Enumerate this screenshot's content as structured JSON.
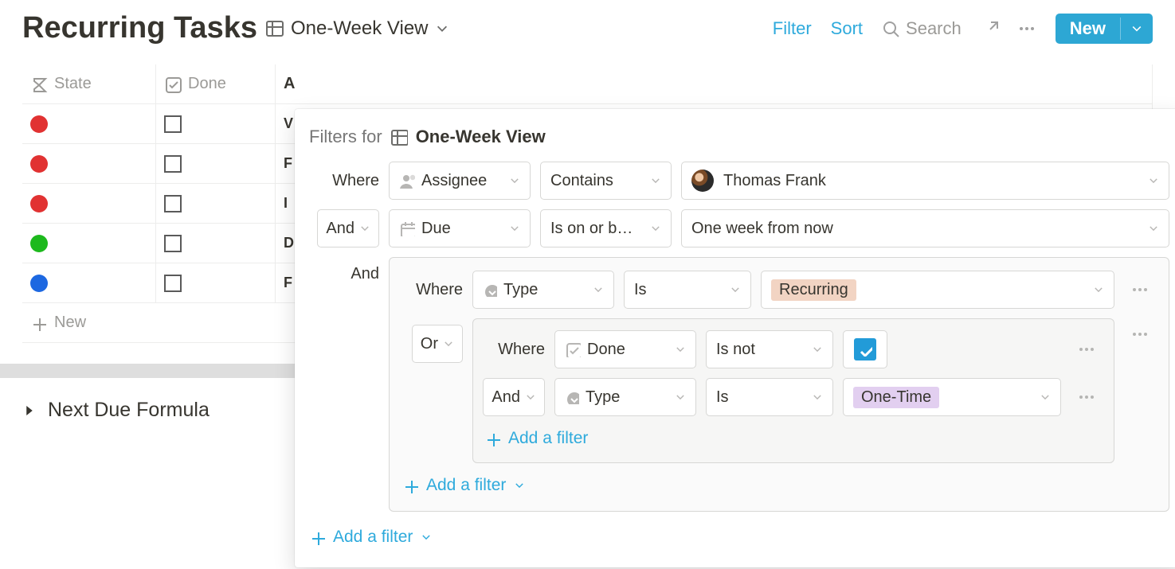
{
  "header": {
    "title": "Recurring Tasks",
    "view_name": "One-Week View",
    "filter": "Filter",
    "sort": "Sort",
    "search": "Search",
    "new": "New"
  },
  "columns": {
    "state": "State",
    "done": "Done"
  },
  "rows": [
    {
      "state_color": "red",
      "done": false,
      "name_initial": "V"
    },
    {
      "state_color": "red",
      "done": false,
      "name_initial": "F"
    },
    {
      "state_color": "red",
      "done": false,
      "name_initial": "I"
    },
    {
      "state_color": "green",
      "done": false,
      "name_initial": "D"
    },
    {
      "state_color": "blue",
      "done": false,
      "name_initial": "F"
    }
  ],
  "new_row": "New",
  "toggle": {
    "label": "Next Due Formula"
  },
  "filters": {
    "title_prefix": "Filters for",
    "view_name": "One-Week View",
    "rule1": {
      "conj": "Where",
      "property": "Assignee",
      "op": "Contains",
      "value": "Thomas Frank"
    },
    "rule2": {
      "conj": "And",
      "property": "Due",
      "op": "Is on or b…",
      "value": "One week from now"
    },
    "group": {
      "conj": "And",
      "rule_a": {
        "conj": "Where",
        "property": "Type",
        "op": "Is",
        "value": "Recurring"
      },
      "nested": {
        "conj": "Or",
        "rule_b": {
          "conj": "Where",
          "property": "Done",
          "op": "Is not",
          "value_checked": true
        },
        "rule_c": {
          "conj": "And",
          "property": "Type",
          "op": "Is",
          "value": "One-Time"
        },
        "add": "Add a filter"
      },
      "add": "Add a filter"
    },
    "add": "Add a filter"
  }
}
